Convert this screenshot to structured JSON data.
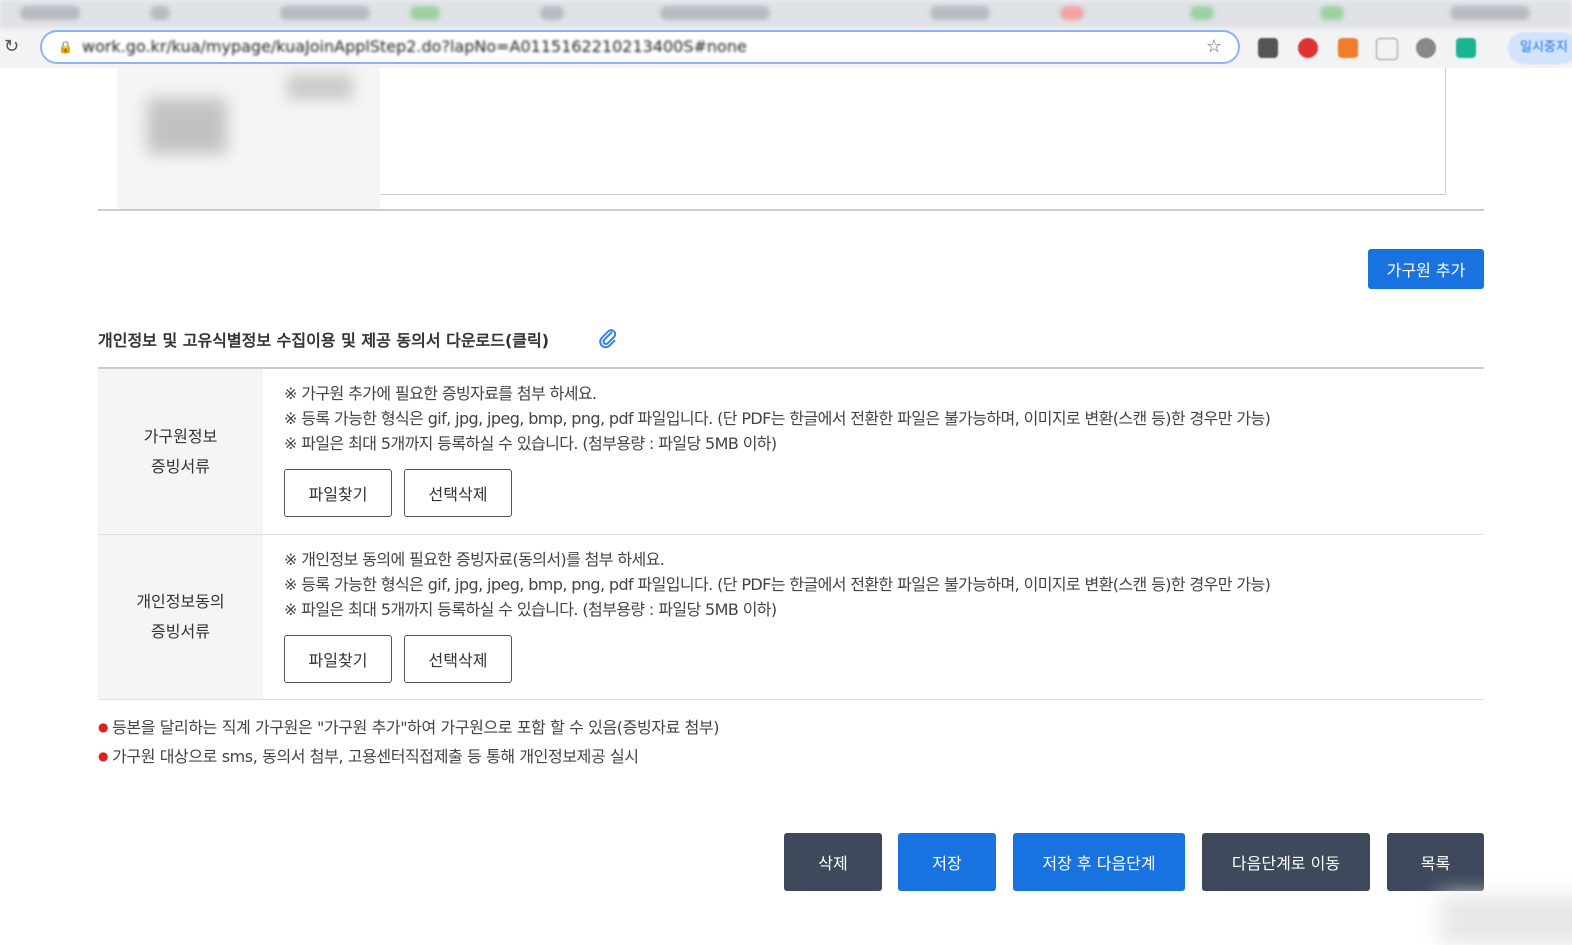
{
  "browser": {
    "url": "work.go.kr/kua/mypage/kuaJoinApplStep2.do?lapNo=A0115162210213400S#none",
    "profile_label": "일시중지"
  },
  "page": {
    "add_member_button": "가구원 추가",
    "consent_download_link": "개인정보 및 고유식별정보 수집이용 및 제공 동의서 다운로드(클릭)",
    "rows": [
      {
        "header_line1": "가구원정보",
        "header_line2": "증빙서류",
        "notices": [
          "※ 가구원 추가에 필요한 증빙자료를 첨부 하세요.",
          "※ 등록 가능한 형식은 gif, jpg, jpeg, bmp, png, pdf 파일입니다. (단 PDF는 한글에서 전환한 파일은 불가능하며, 이미지로 변환(스캔 등)한 경우만 가능)",
          "※ 파일은 최대 5개까지 등록하실 수 있습니다. (첨부용량 : 파일당 5MB 이하)"
        ],
        "find_file_button": "파일찾기",
        "delete_selected_button": "선택삭제"
      },
      {
        "header_line1": "개인정보동의",
        "header_line2": "증빙서류",
        "notices": [
          "※ 개인정보 동의에 필요한 증빙자료(동의서)를 첨부 하세요.",
          "※ 등록 가능한 형식은 gif, jpg, jpeg, bmp, png, pdf 파일입니다. (단 PDF는 한글에서 전환한 파일은 불가능하며, 이미지로 변환(스캔 등)한 경우만 가능)",
          "※ 파일은 최대 5개까지 등록하실 수 있습니다. (첨부용량 : 파일당 5MB 이하)"
        ],
        "find_file_button": "파일찾기",
        "delete_selected_button": "선택삭제"
      }
    ],
    "bullets": [
      "등본을 달리하는 직계 가구원은 \"가구원 추가\"하여 가구원으로 포함 할 수 있음(증빙자료 첨부)",
      "가구원 대상으로 sms, 동의서 첨부, 고용센터직접제출 등 통해 개인정보제공 실시"
    ],
    "footer_buttons": {
      "delete": "삭제",
      "save": "저장",
      "save_next": "저장 후 다음단계",
      "go_next": "다음단계로 이동",
      "list": "목록"
    }
  },
  "colors": {
    "primary_blue": "#1872e0",
    "dark_button": "#3e4a5c",
    "bullet_red": "#e02020",
    "header_bg": "#f5f5f5"
  }
}
